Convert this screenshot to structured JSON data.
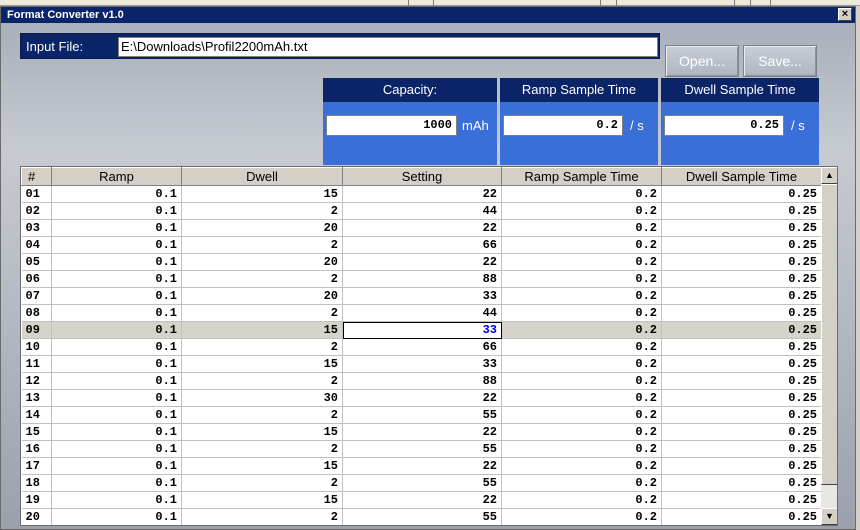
{
  "window": {
    "title": "Format Converter v1.0",
    "close_glyph": "×"
  },
  "input": {
    "label": "Input File:",
    "value": "E:\\Downloads\\Profil2200mAh.txt"
  },
  "buttons": {
    "open_label": "Open...",
    "save_label": "Save..."
  },
  "params": {
    "capacity": {
      "header": "Capacity:",
      "value": "1000",
      "unit": "mAh"
    },
    "ramp": {
      "header": "Ramp Sample Time",
      "value": "0.2",
      "unit": "/ s"
    },
    "dwell": {
      "header": "Dwell Sample Time",
      "value": "0.25",
      "unit": "/ s"
    }
  },
  "table": {
    "columns": [
      "#",
      "Ramp",
      "Dwell",
      "Setting",
      "Ramp Sample Time",
      "Dwell Sample Time"
    ],
    "selected_row": "09",
    "editing_column": "Setting",
    "rows": [
      [
        "01",
        "0.1",
        "15",
        "22",
        "0.2",
        "0.25"
      ],
      [
        "02",
        "0.1",
        "2",
        "44",
        "0.2",
        "0.25"
      ],
      [
        "03",
        "0.1",
        "20",
        "22",
        "0.2",
        "0.25"
      ],
      [
        "04",
        "0.1",
        "2",
        "66",
        "0.2",
        "0.25"
      ],
      [
        "05",
        "0.1",
        "20",
        "22",
        "0.2",
        "0.25"
      ],
      [
        "06",
        "0.1",
        "2",
        "88",
        "0.2",
        "0.25"
      ],
      [
        "07",
        "0.1",
        "20",
        "33",
        "0.2",
        "0.25"
      ],
      [
        "08",
        "0.1",
        "2",
        "44",
        "0.2",
        "0.25"
      ],
      [
        "09",
        "0.1",
        "15",
        "33",
        "0.2",
        "0.25"
      ],
      [
        "10",
        "0.1",
        "2",
        "66",
        "0.2",
        "0.25"
      ],
      [
        "11",
        "0.1",
        "15",
        "33",
        "0.2",
        "0.25"
      ],
      [
        "12",
        "0.1",
        "2",
        "88",
        "0.2",
        "0.25"
      ],
      [
        "13",
        "0.1",
        "30",
        "22",
        "0.2",
        "0.25"
      ],
      [
        "14",
        "0.1",
        "2",
        "55",
        "0.2",
        "0.25"
      ],
      [
        "15",
        "0.1",
        "15",
        "22",
        "0.2",
        "0.25"
      ],
      [
        "16",
        "0.1",
        "2",
        "55",
        "0.2",
        "0.25"
      ],
      [
        "17",
        "0.1",
        "15",
        "22",
        "0.2",
        "0.25"
      ],
      [
        "18",
        "0.1",
        "2",
        "55",
        "0.2",
        "0.25"
      ],
      [
        "19",
        "0.1",
        "15",
        "22",
        "0.2",
        "0.25"
      ],
      [
        "20",
        "0.1",
        "2",
        "55",
        "0.2",
        "0.25"
      ]
    ]
  },
  "scrollbar": {
    "up_glyph": "▲",
    "down_glyph": "▼",
    "position": 0,
    "visible_fraction": 0.93
  },
  "colors": {
    "header_navy": "#0b2468",
    "panel_blue": "#3a6fd8",
    "selected_row": "#d6d3cb",
    "edit_text": "#0000d8"
  }
}
